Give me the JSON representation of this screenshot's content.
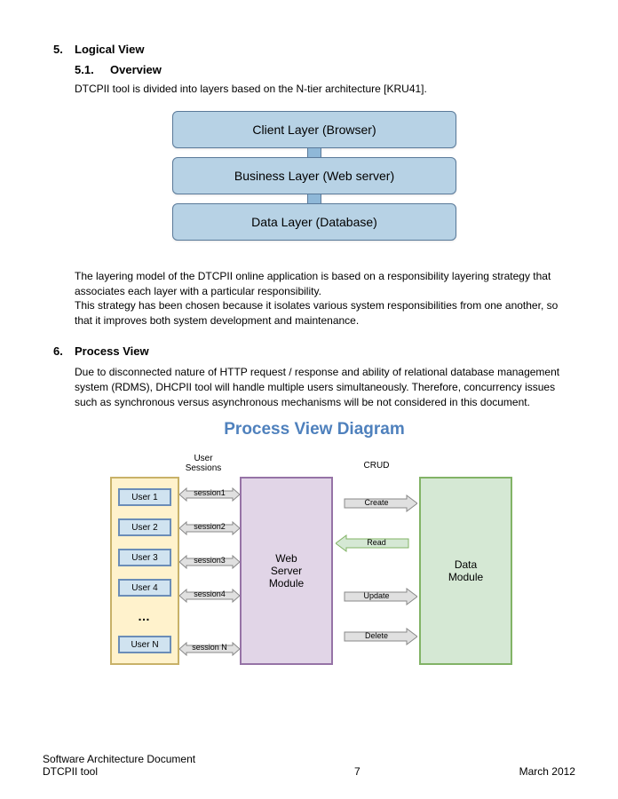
{
  "section5": {
    "number": "5.",
    "title": "Logical View",
    "sub": {
      "number": "5.1.",
      "title": "Overview",
      "intro": "DTCPII tool is divided into layers based on the N-tier architecture [KRU41]."
    },
    "layers": {
      "client": "Client Layer (Browser)",
      "business": "Business Layer (Web server)",
      "data": "Data Layer (Database)"
    },
    "para1": "The layering model of the DTCPII online application is based on a responsibility layering strategy that associates each layer with a particular responsibility.",
    "para2": "This strategy has been chosen because it isolates various system responsibilities from one another, so that it improves both system development and maintenance."
  },
  "section6": {
    "number": "6.",
    "title": "Process View",
    "para": "Due to disconnected nature of HTTP request / response and ability of relational database management system (RDMS), DHCPII tool will handle multiple users simultaneously. Therefore, concurrency issues such as synchronous versus asynchronous mechanisms will be not considered in this document.",
    "diagram_title": "Process View Diagram",
    "labels": {
      "sessions": "User\nSessions",
      "crud": "CRUD",
      "web_server": "Web Server Module",
      "data_module": "Data Module"
    },
    "users": [
      "User 1",
      "User 2",
      "User 3",
      "User 4",
      "User N"
    ],
    "dots": "…",
    "session_arrows": [
      "session1",
      "session2",
      "session3",
      "session4",
      "session N"
    ],
    "crud_arrows": [
      "Create",
      "Read",
      "Update",
      "Delete"
    ]
  },
  "footer": {
    "doc": "Software Architecture Document",
    "tool": "DTCPII tool",
    "page": "7",
    "date": "March 2012"
  }
}
